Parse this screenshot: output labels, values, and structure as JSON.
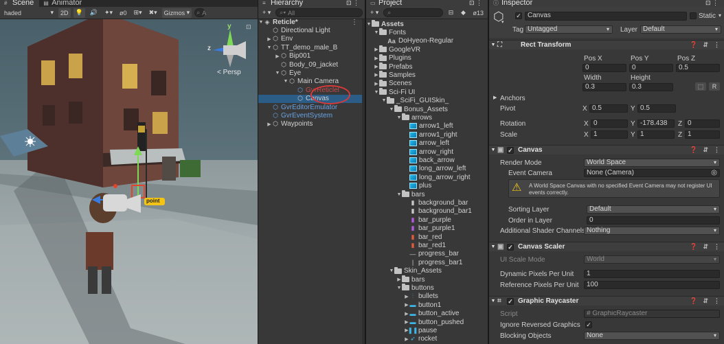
{
  "scene": {
    "tabs": [
      "Scene",
      "Animator"
    ],
    "toolbar": {
      "shading": "haded",
      "mode_2d": "2D",
      "gizmo_count": "0",
      "gizmos": "Gizmos",
      "search_prefix": "A"
    },
    "persp": "< Persp",
    "axis_y": "y",
    "axis_z": "z",
    "point_label": "point"
  },
  "hierarchy": {
    "title": "Hierarchy",
    "search_placeholder": "All",
    "add": "+ ▾",
    "items": [
      {
        "label": "Reticle*",
        "depth": 0,
        "arrow": "▼",
        "icon": "unity",
        "bold": true
      },
      {
        "label": "Directional Light",
        "depth": 1,
        "arrow": "",
        "icon": "cube"
      },
      {
        "label": "Env",
        "depth": 1,
        "arrow": "▶",
        "icon": "cube"
      },
      {
        "label": "TT_demo_male_B",
        "depth": 1,
        "arrow": "▼",
        "icon": "cube"
      },
      {
        "label": "Bip001",
        "depth": 2,
        "arrow": "▶",
        "icon": "cube"
      },
      {
        "label": "Body_09_jacket",
        "depth": 2,
        "arrow": "",
        "icon": "cube"
      },
      {
        "label": "Eye",
        "depth": 2,
        "arrow": "▼",
        "icon": "cube"
      },
      {
        "label": "Main Camera",
        "depth": 3,
        "arrow": "▼",
        "icon": "cube"
      },
      {
        "label": "GvrReticlel",
        "depth": 4,
        "arrow": "",
        "icon": "cube-blue",
        "color": "red"
      },
      {
        "label": "Canvas",
        "depth": 4,
        "arrow": "",
        "icon": "cube",
        "selected": true
      },
      {
        "label": "GvrEditorEmulator",
        "depth": 1,
        "arrow": "",
        "icon": "cube-blue",
        "color": "blue"
      },
      {
        "label": "GvrEventSystem",
        "depth": 1,
        "arrow": "",
        "icon": "cube-blue",
        "color": "blue"
      },
      {
        "label": "Waypoints",
        "depth": 1,
        "arrow": "▶",
        "icon": "cube"
      }
    ]
  },
  "project": {
    "title": "Project",
    "add": "+ ▾",
    "count": "13",
    "items": [
      {
        "label": "Assets",
        "depth": 0,
        "arrow": "▼",
        "icon": "folder",
        "bold": true
      },
      {
        "label": "Fonts",
        "depth": 1,
        "arrow": "▼",
        "icon": "folder"
      },
      {
        "label": "DoHyeon-Regular",
        "depth": 2,
        "arrow": "",
        "icon": "font"
      },
      {
        "label": "GoogleVR",
        "depth": 1,
        "arrow": "▶",
        "icon": "folder"
      },
      {
        "label": "Plugins",
        "depth": 1,
        "arrow": "▶",
        "icon": "folder"
      },
      {
        "label": "Prefabs",
        "depth": 1,
        "arrow": "▶",
        "icon": "folder"
      },
      {
        "label": "Samples",
        "depth": 1,
        "arrow": "▶",
        "icon": "folder"
      },
      {
        "label": "Scenes",
        "depth": 1,
        "arrow": "▶",
        "icon": "folder"
      },
      {
        "label": "Sci-Fi UI",
        "depth": 1,
        "arrow": "▼",
        "icon": "folder"
      },
      {
        "label": "_SciFi_GUISkin_",
        "depth": 2,
        "arrow": "▼",
        "icon": "folder"
      },
      {
        "label": "Bonus_Assets",
        "depth": 3,
        "arrow": "▼",
        "icon": "folder"
      },
      {
        "label": "arrows",
        "depth": 4,
        "arrow": "▼",
        "icon": "folder"
      },
      {
        "label": "arrow1_left",
        "depth": 5,
        "arrow": "",
        "icon": "img"
      },
      {
        "label": "arrow1_right",
        "depth": 5,
        "arrow": "",
        "icon": "img"
      },
      {
        "label": "arrow_left",
        "depth": 5,
        "arrow": "",
        "icon": "img"
      },
      {
        "label": "arrow_right",
        "depth": 5,
        "arrow": "",
        "icon": "img"
      },
      {
        "label": "back_arrow",
        "depth": 5,
        "arrow": "",
        "icon": "img"
      },
      {
        "label": "long_arrow_left",
        "depth": 5,
        "arrow": "",
        "icon": "img"
      },
      {
        "label": "long_arrow_right",
        "depth": 5,
        "arrow": "",
        "icon": "img"
      },
      {
        "label": "plus",
        "depth": 5,
        "arrow": "",
        "icon": "img"
      },
      {
        "label": "bars",
        "depth": 4,
        "arrow": "▼",
        "icon": "folder"
      },
      {
        "label": "background_bar",
        "depth": 5,
        "arrow": "",
        "icon": "bar"
      },
      {
        "label": "background_bar1",
        "depth": 5,
        "arrow": "",
        "icon": "bar"
      },
      {
        "label": "bar_purple",
        "depth": 5,
        "arrow": "",
        "icon": "bar-purple"
      },
      {
        "label": "bar_purple1",
        "depth": 5,
        "arrow": "",
        "icon": "bar-purple"
      },
      {
        "label": "bar_red",
        "depth": 5,
        "arrow": "",
        "icon": "bar-red"
      },
      {
        "label": "bar_red1",
        "depth": 5,
        "arrow": "",
        "icon": "bar-red"
      },
      {
        "label": "progress_bar",
        "depth": 5,
        "arrow": "",
        "icon": "line"
      },
      {
        "label": "progress_bar1",
        "depth": 5,
        "arrow": "",
        "icon": "vline"
      },
      {
        "label": "Skin_Assets",
        "depth": 3,
        "arrow": "▼",
        "icon": "folder"
      },
      {
        "label": "bars",
        "depth": 4,
        "arrow": "▶",
        "icon": "folder"
      },
      {
        "label": "buttons",
        "depth": 4,
        "arrow": "▼",
        "icon": "folder"
      },
      {
        "label": "bullets",
        "depth": 5,
        "arrow": "▶",
        "icon": "bullets"
      },
      {
        "label": "button1",
        "depth": 5,
        "arrow": "▶",
        "icon": "btn"
      },
      {
        "label": "button_active",
        "depth": 5,
        "arrow": "▶",
        "icon": "btn"
      },
      {
        "label": "button_pushed",
        "depth": 5,
        "arrow": "▶",
        "icon": "btn"
      },
      {
        "label": "pause",
        "depth": 5,
        "arrow": "▶",
        "icon": "pause"
      },
      {
        "label": "rocket",
        "depth": 5,
        "arrow": "▶",
        "icon": "rocket"
      }
    ]
  },
  "inspector": {
    "title": "Inspector",
    "object_name": "Canvas",
    "static_label": "Static",
    "tag_label": "Tag",
    "tag_value": "Untagged",
    "layer_label": "Layer",
    "layer_value": "Default",
    "rect_transform": {
      "title": "Rect Transform",
      "pos_x_label": "Pos X",
      "pos_y_label": "Pos Y",
      "pos_z_label": "Pos Z",
      "pos_x": "0",
      "pos_y": "0",
      "pos_z": "0.5",
      "width_label": "Width",
      "height_label": "Height",
      "width": "0.3",
      "height": "0.3",
      "anchors": "Anchors",
      "pivot": "Pivot",
      "pivot_x": "0.5",
      "pivot_y": "0.5",
      "rotation": "Rotation",
      "rot_x": "0",
      "rot_y": "-178.438",
      "rot_z": "0",
      "scale": "Scale",
      "scale_x": "1",
      "scale_y": "1",
      "scale_z": "1",
      "r_btn": "R"
    },
    "canvas": {
      "title": "Canvas",
      "render_mode_label": "Render Mode",
      "render_mode": "World Space",
      "event_camera_label": "Event Camera",
      "event_camera": "None (Camera)",
      "warning": "A World Space Canvas with no specified Event Camera may not register UI events correctly.",
      "sorting_layer_label": "Sorting Layer",
      "sorting_layer": "Default",
      "order_label": "Order in Layer",
      "order": "0",
      "shader_label": "Additional Shader Channels",
      "shader": "Nothing"
    },
    "scaler": {
      "title": "Canvas Scaler",
      "scale_mode_label": "UI Scale Mode",
      "scale_mode": "World",
      "dpu_label": "Dynamic Pixels Per Unit",
      "dpu": "1",
      "rppu_label": "Reference Pixels Per Unit",
      "rppu": "100"
    },
    "raycaster": {
      "title": "Graphic Raycaster",
      "script_label": "Script",
      "script": "GraphicRaycaster",
      "ignore_label": "Ignore Reversed Graphics",
      "blocking_label": "Blocking Objects",
      "blocking": "None"
    }
  }
}
